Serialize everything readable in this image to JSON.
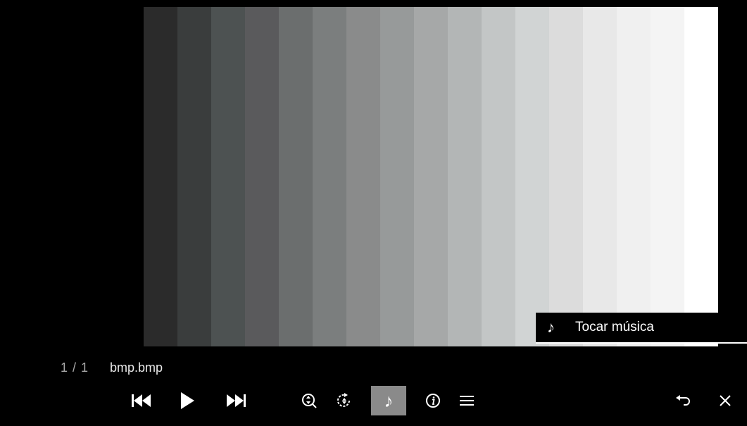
{
  "viewer": {
    "counter": "1 / 1",
    "filename": "bmp.bmp"
  },
  "image": {
    "steps": [
      "#2b2b2b",
      "#3a3d3d",
      "#4d5252",
      "#5a5a5c",
      "#6b6e6e",
      "#7b7e7e",
      "#8a8b8b",
      "#979a9a",
      "#a6a8a8",
      "#b3b6b6",
      "#c3c6c6",
      "#d1d4d4",
      "#dcdcdc",
      "#e8e8e8",
      "#f0f0f0",
      "#f4f4f4",
      "#ffffff"
    ]
  },
  "tooltip": {
    "icon": "music-note-icon",
    "text": "Tocar música"
  },
  "controls": {
    "previous": "skip-previous-icon",
    "play": "play-icon",
    "next": "skip-next-icon",
    "zoom": "zoom-icon",
    "rotate": "rotate-icon",
    "music": "music-note-icon",
    "info": "info-icon",
    "menu": "menu-icon",
    "back": "back-icon",
    "close": "close-icon"
  },
  "colors": {
    "background": "#000000",
    "active_button": "#8a8a8a"
  }
}
